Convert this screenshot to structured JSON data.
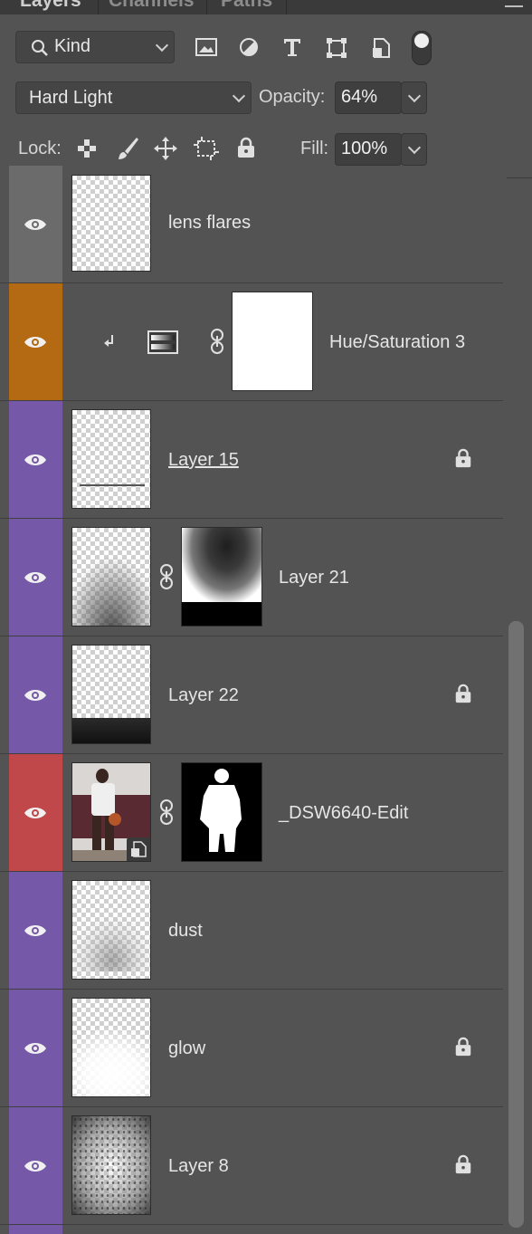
{
  "tabs": [
    {
      "label": "Layers",
      "active": true
    },
    {
      "label": "Channels",
      "active": false
    },
    {
      "label": "Paths",
      "active": false
    }
  ],
  "filter": {
    "kind_label": "Kind",
    "filter_icons": [
      "image-filter-icon",
      "adjustment-filter-icon",
      "type-filter-icon",
      "shape-filter-icon",
      "smart-object-filter-icon",
      "filter-toggle-icon"
    ]
  },
  "blend": {
    "mode": "Hard Light",
    "opacity_label": "Opacity:",
    "opacity_value": "64%"
  },
  "lock": {
    "label": "Lock:",
    "icons": [
      "lock-transparent-pixels-icon",
      "lock-image-pixels-icon",
      "lock-position-icon",
      "lock-artboard-icon",
      "lock-all-icon"
    ],
    "fill_label": "Fill:",
    "fill_value": "100%"
  },
  "colors": {
    "gray": "#6b6b6b",
    "orange": "#b36a12",
    "violet": "#7559a8",
    "red": "#c0474a",
    "panel": "#535353"
  },
  "layers": [
    {
      "name": "lens flares",
      "color": "gray",
      "locked": false,
      "type": "pixel",
      "underlined": false
    },
    {
      "name": "Hue/Saturation 3",
      "color": "orange",
      "locked": false,
      "type": "adjustment",
      "clipped": true
    },
    {
      "name": "Layer 15",
      "color": "violet",
      "locked": true,
      "type": "pixel",
      "underlined": true
    },
    {
      "name": "Layer 21",
      "color": "violet",
      "locked": false,
      "type": "masked"
    },
    {
      "name": "Layer 22",
      "color": "violet",
      "locked": true,
      "type": "pixel"
    },
    {
      "name": "_DSW6640-Edit",
      "color": "red",
      "locked": false,
      "type": "smart-masked"
    },
    {
      "name": "dust",
      "color": "violet",
      "locked": false,
      "type": "pixel"
    },
    {
      "name": "glow",
      "color": "violet",
      "locked": true,
      "type": "pixel"
    },
    {
      "name": "Layer 8",
      "color": "violet",
      "locked": true,
      "type": "pixel"
    }
  ]
}
